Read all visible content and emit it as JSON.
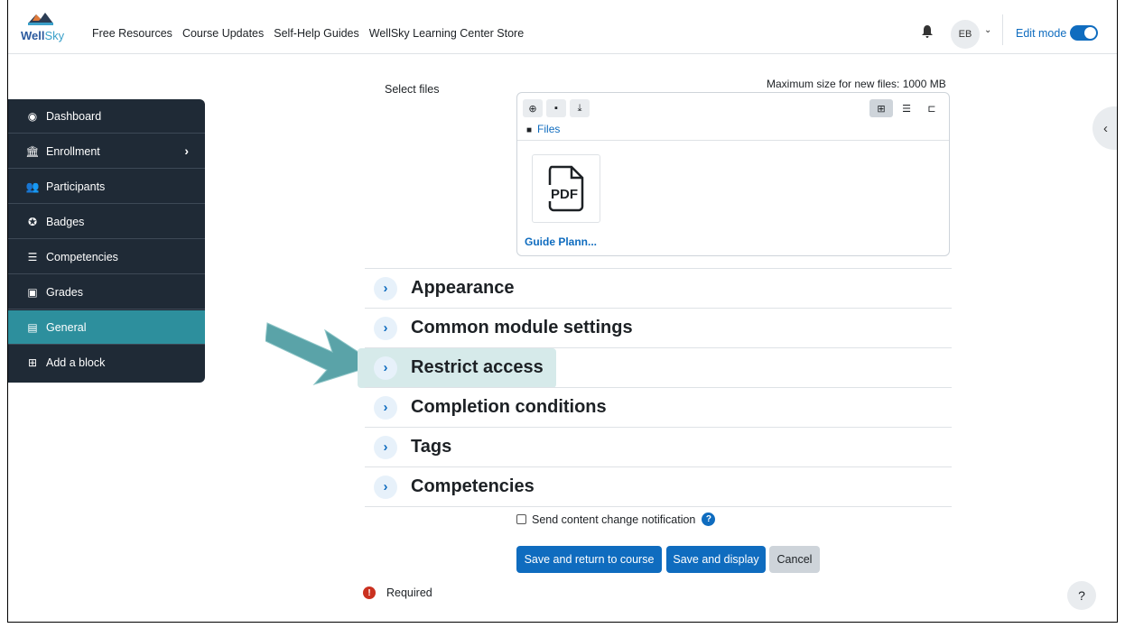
{
  "brand": {
    "name_part1": "Well",
    "name_part2": "Sky"
  },
  "nav": {
    "links": [
      "Free Resources",
      "Course Updates",
      "Self-Help Guides",
      "WellSky Learning Center Store"
    ],
    "avatar_initials": "EB",
    "edit_mode_label": "Edit mode",
    "edit_mode_on": true
  },
  "sidebar": {
    "items": [
      {
        "label": "Dashboard",
        "icon": "dashboard-icon"
      },
      {
        "label": "Enrollment",
        "icon": "institution-icon"
      },
      {
        "label": "Participants",
        "icon": "users-icon"
      },
      {
        "label": "Badges",
        "icon": "badge-icon"
      },
      {
        "label": "Competencies",
        "icon": "list-check-icon"
      },
      {
        "label": "Grades",
        "icon": "clipboard-icon"
      },
      {
        "label": "General",
        "icon": "list-icon"
      },
      {
        "label": "Add a block",
        "icon": "plus-square-icon"
      }
    ],
    "active_item": "General"
  },
  "filepicker": {
    "label": "Select files",
    "max_size": "Maximum size for new files: 1000 MB",
    "breadcrumb": "Files",
    "file_type": "PDF",
    "file_name": "Guide Plann..."
  },
  "sections": [
    {
      "title": "Appearance"
    },
    {
      "title": "Common module settings"
    },
    {
      "title": "Restrict access",
      "highlighted": true
    },
    {
      "title": "Completion conditions"
    },
    {
      "title": "Tags"
    },
    {
      "title": "Competencies"
    }
  ],
  "notification": {
    "label": "Send content change notification",
    "checked": false
  },
  "buttons": {
    "save_return": "Save and return to course",
    "save_display": "Save and display",
    "cancel": "Cancel"
  },
  "required_label": "Required",
  "help_fab": "?",
  "colors": {
    "primary": "#0f6cbf",
    "drawer": "#1f2a36",
    "active": "#2d8f9d",
    "arrow": "#5aa3a8"
  }
}
